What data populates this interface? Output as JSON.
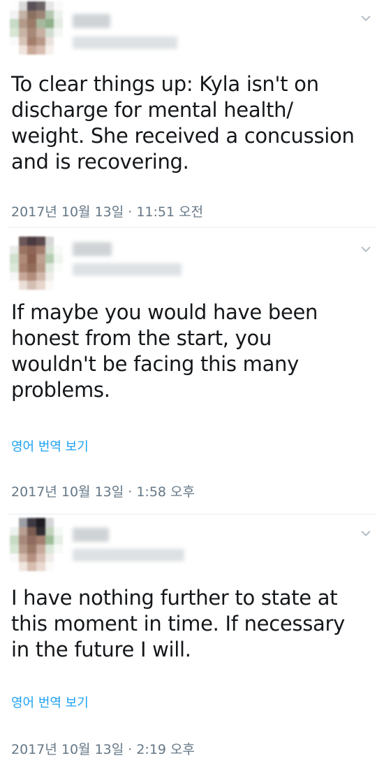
{
  "tweets": [
    {
      "text": "To clear things up: Kyla isn't on\ndischarge for mental health/\nweight. She received a concussion\nand is recovering.",
      "translate_label": "",
      "timestamp": "2017년 10월 13일 · 11:51 오전"
    },
    {
      "text": "If maybe you would have been\nhonest from the start, you\nwouldn't be facing this many\nproblems.",
      "translate_label": "영어 번역 보기",
      "timestamp": "2017년 10월 13일 · 1:58 오후"
    },
    {
      "text": "I have nothing further to state at\nthis moment in time. If necessary\nin the future I will.",
      "translate_label": "영어 번역 보기",
      "timestamp": "2017년 10월 13일 · 2:19 오후"
    }
  ],
  "icons": {
    "more": "chevron-down-icon",
    "avatar": "blurred-avatar",
    "name": "blurred-name",
    "handle": "blurred-handle"
  },
  "colors": {
    "text": "#14171a",
    "link": "#1da1f2",
    "muted": "#657786",
    "divider": "#e6ecf0"
  }
}
